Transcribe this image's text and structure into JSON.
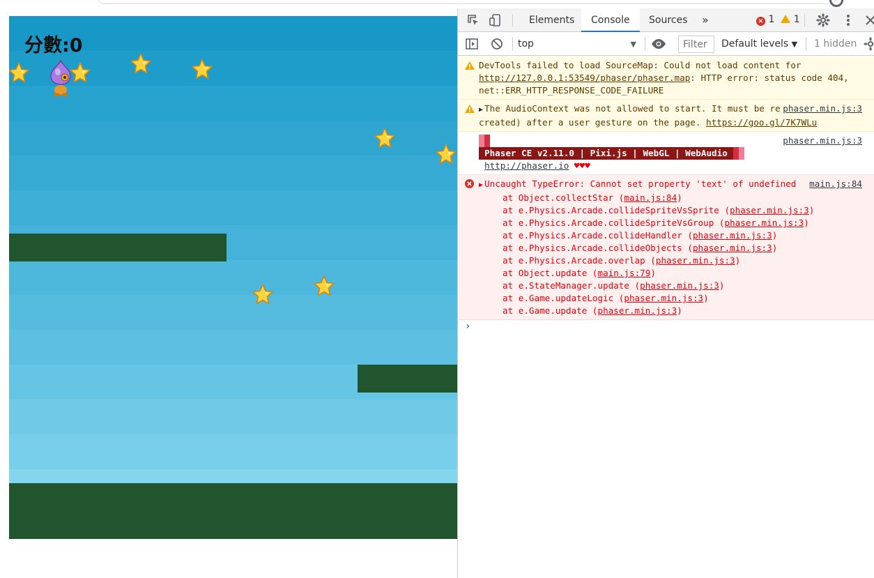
{
  "game": {
    "score_label": "分數:0"
  },
  "devtools": {
    "tabs": [
      {
        "label": "Elements"
      },
      {
        "label": "Console"
      },
      {
        "label": "Sources"
      }
    ],
    "more_tabs": "»",
    "error_count": "1",
    "warning_count": "1",
    "toolbar": {
      "context": "top",
      "filter_placeholder": "Filter",
      "levels": "Default levels",
      "hidden": "1 hidden"
    },
    "messages": {
      "sourcemap_text1": "DevTools failed to load SourceMap: Could not load content for ",
      "sourcemap_url": "http://127.0.0.1:53549/phaser/phaser.map",
      "sourcemap_text2": ": HTTP error: status code 404, net::ERR_HTTP_RESPONSE_CODE_FAILURE",
      "audio_text": "The AudioContext was not allowed to start. It must be resumed (or created) after a user gesture on the page. ",
      "audio_url": "https://goo.gl/7K7WLu",
      "audio_source": "phaser.min.js:3",
      "phaser_banner": "Phaser CE v2.11.0 | Pixi.js | WebGL | WebAudio",
      "phaser_link": "http://phaser.io",
      "phaser_hearts": "♥♥♥",
      "phaser_source": "phaser.min.js:3",
      "error_text": "Uncaught TypeError: Cannot set property 'text' of undefined",
      "error_source": "main.js:84",
      "stack": [
        {
          "fn": "at Object.collectStar (",
          "link": "main.js:84"
        },
        {
          "fn": "at e.Physics.Arcade.collideSpriteVsSprite (",
          "link": "phaser.min.js:3"
        },
        {
          "fn": "at e.Physics.Arcade.collideSpriteVsGroup (",
          "link": "phaser.min.js:3"
        },
        {
          "fn": "at e.Physics.Arcade.collideHandler (",
          "link": "phaser.min.js:3"
        },
        {
          "fn": "at e.Physics.Arcade.collideObjects (",
          "link": "phaser.min.js:3"
        },
        {
          "fn": "at e.Physics.Arcade.overlap (",
          "link": "phaser.min.js:3"
        },
        {
          "fn": "at Object.update (",
          "link": "main.js:79"
        },
        {
          "fn": "at e.StateManager.update (",
          "link": "phaser.min.js:3"
        },
        {
          "fn": "at e.Game.updateLogic (",
          "link": "phaser.min.js:3"
        },
        {
          "fn": "at e.Game.update (",
          "link": "phaser.min.js:3"
        }
      ],
      "prompt": "›"
    }
  }
}
